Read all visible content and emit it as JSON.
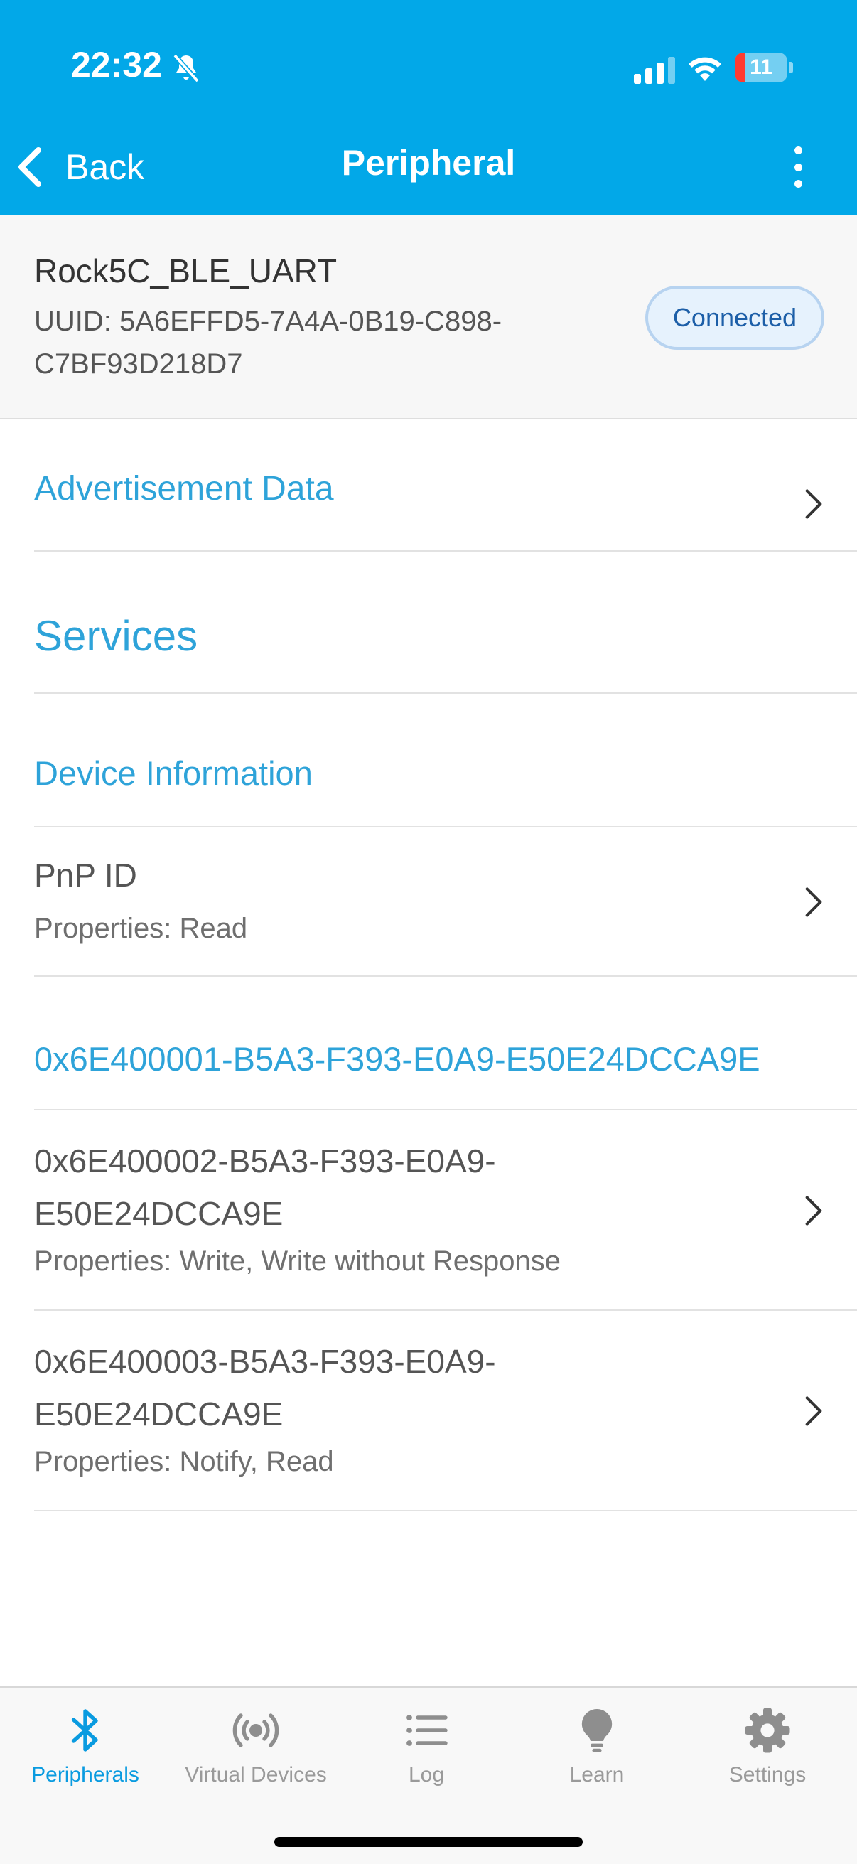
{
  "status_bar": {
    "time": "22:32",
    "battery_level": "11"
  },
  "nav": {
    "back_label": "Back",
    "title": "Peripheral"
  },
  "device": {
    "name": "Rock5C_BLE_UART",
    "uuid": "UUID: 5A6EFFD5-7A4A-0B19-C898-C7BF93D218D7",
    "status": "Connected"
  },
  "advertisement": {
    "label": "Advertisement Data"
  },
  "services": {
    "header": "Services",
    "list": [
      {
        "title": "Device Information",
        "characteristics": [
          {
            "name": "PnP ID",
            "properties": "Properties: Read"
          }
        ]
      },
      {
        "title": "0x6E400001-B5A3-F393-E0A9-E50E24DCCA9E",
        "characteristics": [
          {
            "name": "0x6E400002-B5A3-F393-E0A9-E50E24DCCA9E",
            "properties": "Properties: Write, Write without Response"
          },
          {
            "name": "0x6E400003-B5A3-F393-E0A9-E50E24DCCA9E",
            "properties": "Properties: Notify, Read"
          }
        ]
      }
    ]
  },
  "tabs": [
    {
      "label": "Peripherals",
      "icon": "bluetooth-icon",
      "active": true
    },
    {
      "label": "Virtual Devices",
      "icon": "broadcast-icon",
      "active": false
    },
    {
      "label": "Log",
      "icon": "list-icon",
      "active": false
    },
    {
      "label": "Learn",
      "icon": "lightbulb-icon",
      "active": false
    },
    {
      "label": "Settings",
      "icon": "gear-icon",
      "active": false
    }
  ],
  "colors": {
    "header": "#02a8e8",
    "accent": "#2ea3d9",
    "tab_active": "#0a9be0"
  }
}
